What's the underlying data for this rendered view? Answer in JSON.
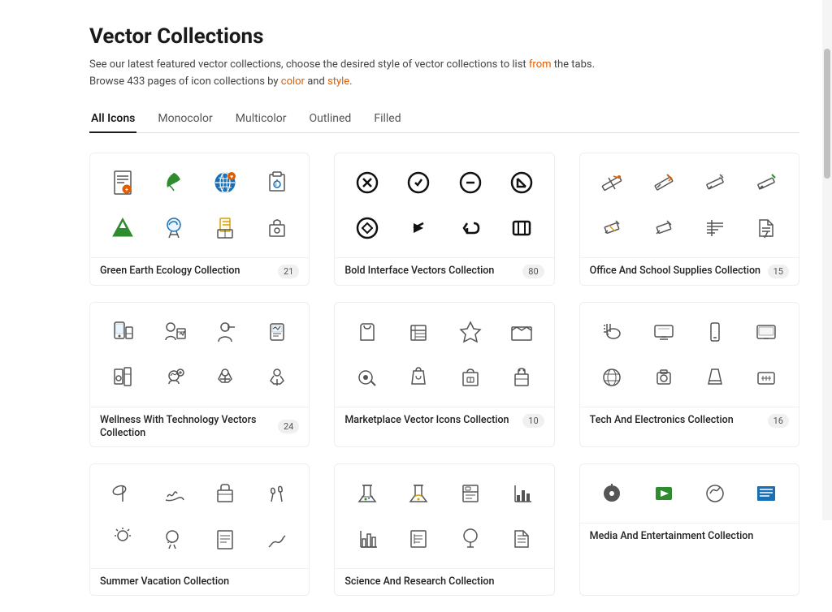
{
  "page": {
    "title": "Vector Collections",
    "subtitle_line1": "See our latest featured vector collections, choose the desired style of vector collections to list from the tabs.",
    "subtitle_line2": "Browse 433 pages of icon collections by color and style.",
    "subtitle_link1": "from",
    "subtitle_link2": "color",
    "subtitle_link3": "style"
  },
  "tabs": [
    {
      "id": "all",
      "label": "All Icons",
      "active": true
    },
    {
      "id": "monocolor",
      "label": "Monocolor",
      "active": false
    },
    {
      "id": "multicolor",
      "label": "Multicolor",
      "active": false
    },
    {
      "id": "outlined",
      "label": "Outlined",
      "active": false
    },
    {
      "id": "filled",
      "label": "Filled",
      "active": false
    }
  ],
  "collections": [
    {
      "id": "green-earth",
      "title": "Green Earth Ecology Collection",
      "count": "21",
      "row": 1
    },
    {
      "id": "bold-interface",
      "title": "Bold Interface Vectors Collection",
      "count": "80",
      "row": 1
    },
    {
      "id": "office-school",
      "title": "Office And School Supplies Collection",
      "count": "15",
      "row": 1
    },
    {
      "id": "wellness",
      "title": "Wellness With Technology Vectors Collection",
      "count": "24",
      "row": 2
    },
    {
      "id": "marketplace",
      "title": "Marketplace Vector Icons Collection",
      "count": "10",
      "row": 2
    },
    {
      "id": "tech-electronics",
      "title": "Tech And Electronics Collection",
      "count": "16",
      "row": 2
    },
    {
      "id": "summer",
      "title": "Summer Vacation Collection",
      "count": "",
      "row": 3
    },
    {
      "id": "science",
      "title": "Science And Research Collection",
      "count": "",
      "row": 3
    },
    {
      "id": "media",
      "title": "Media And Entertainment Collection",
      "count": "",
      "row": 3
    }
  ]
}
